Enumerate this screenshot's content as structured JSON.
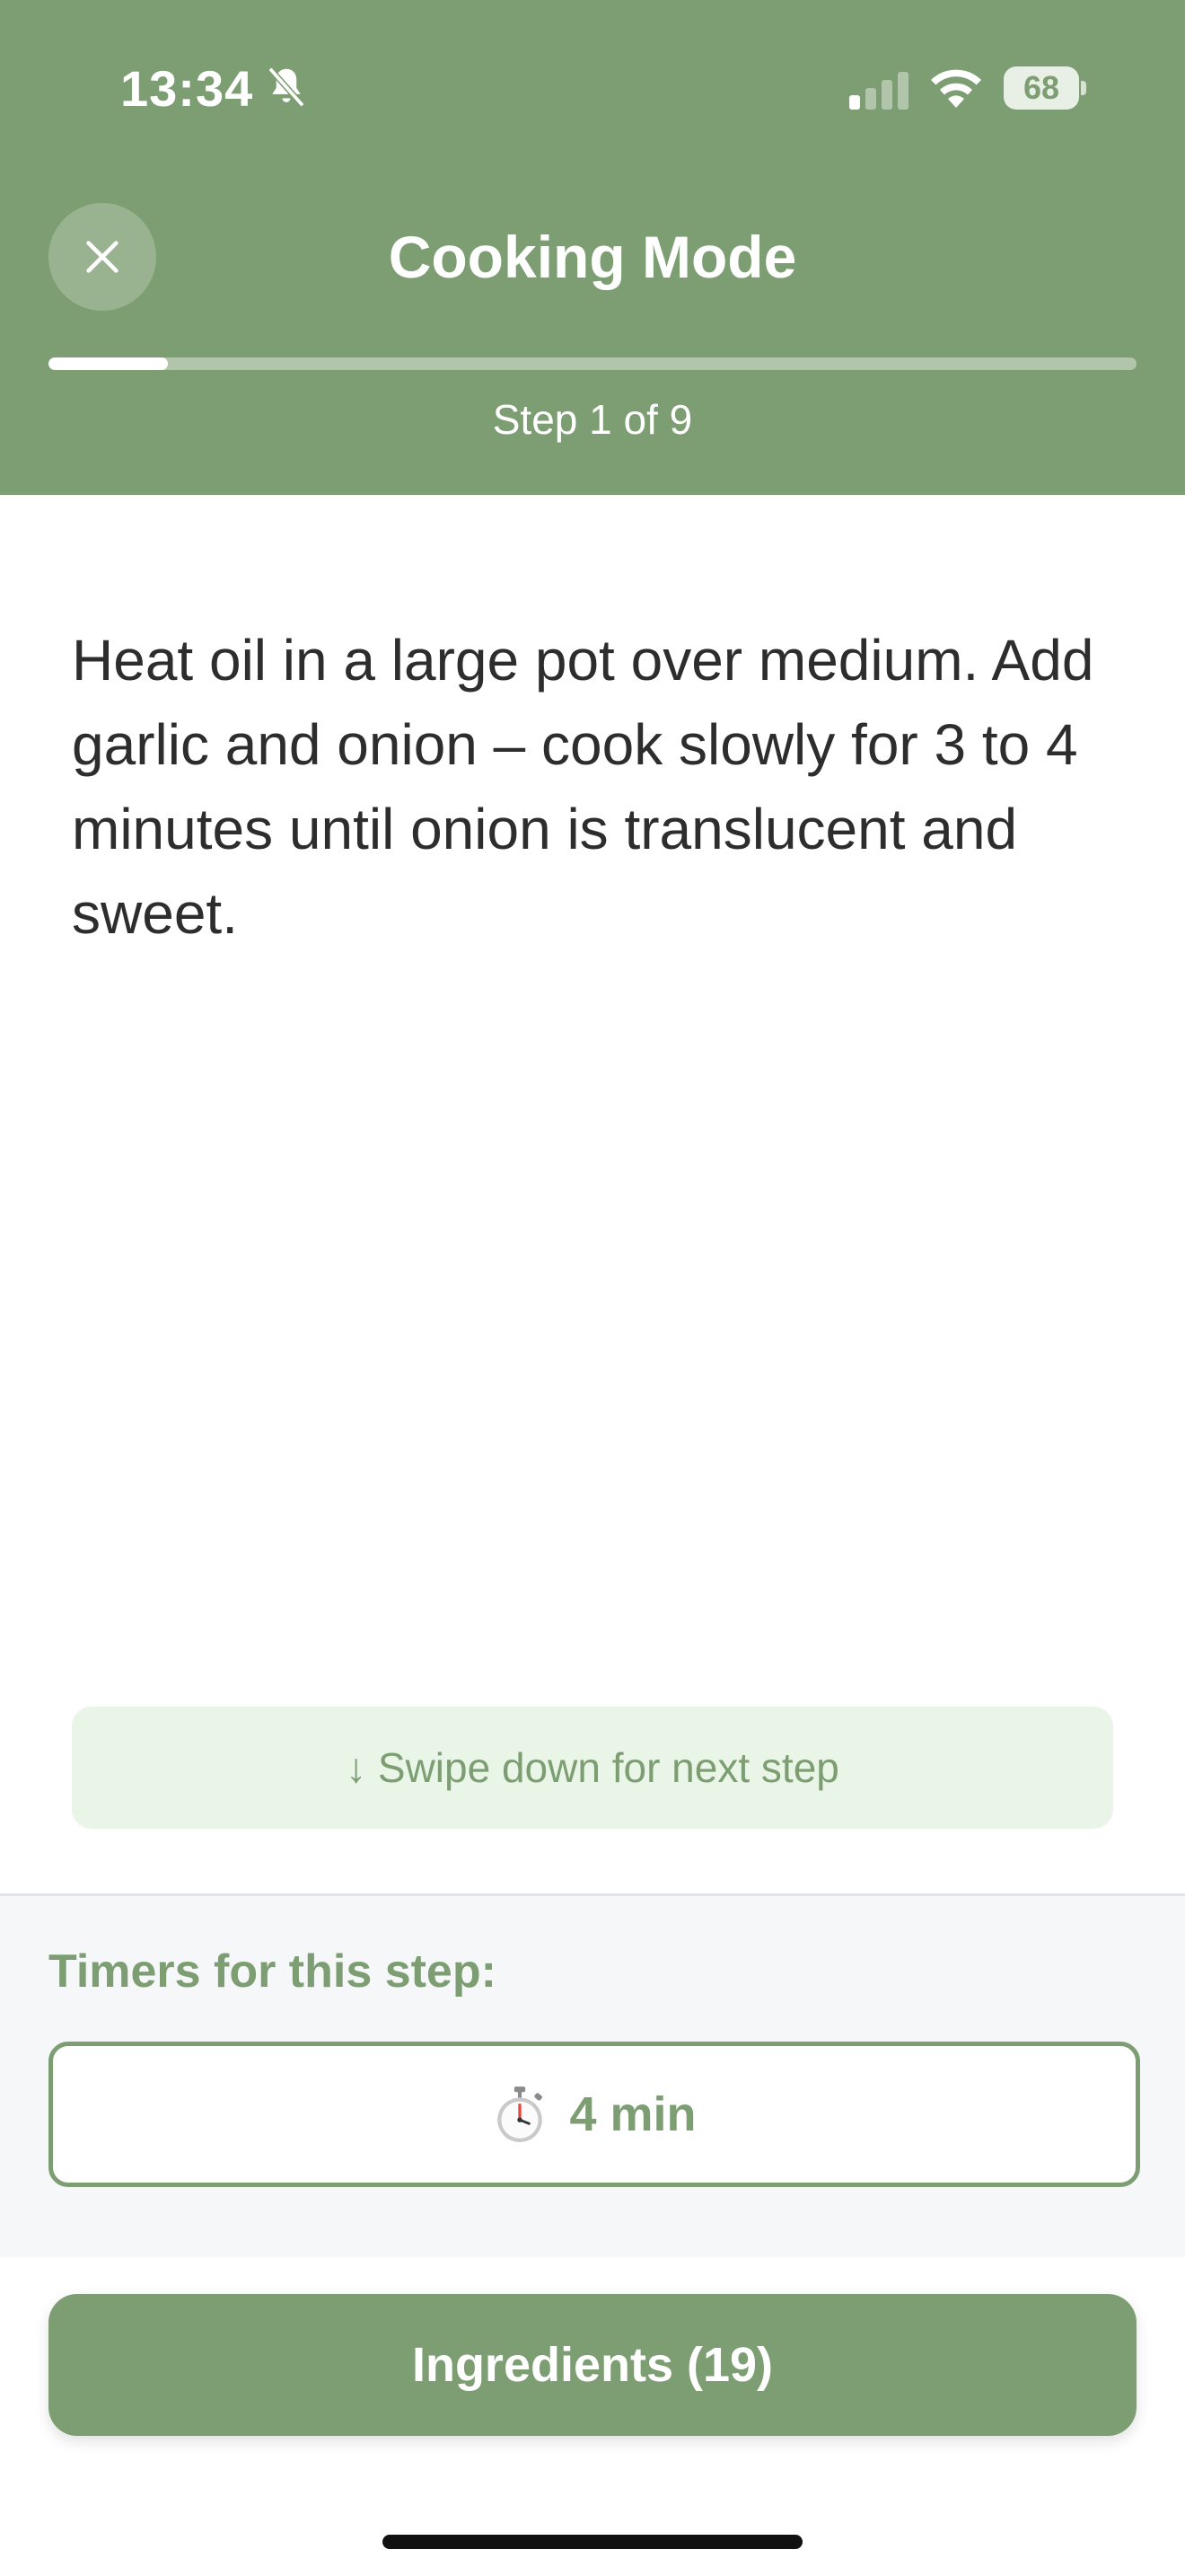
{
  "status_bar": {
    "time": "13:34",
    "battery": "68"
  },
  "header": {
    "title": "Cooking Mode",
    "step_counter": "Step 1 of 9",
    "progress": 0.11,
    "close_icon": "close-icon"
  },
  "step": {
    "text": "Heat oil in a large pot over medium. Add garlic and onion – cook slowly for 3 to 4 minutes until onion is translucent and sweet."
  },
  "swipe_hint": "↓ Swipe down for next step",
  "timers": {
    "label": "Timers for this step:",
    "items": [
      {
        "label": "4 min",
        "icon": "stopwatch-icon"
      }
    ]
  },
  "ingredients_button": "Ingredients (19)",
  "colors": {
    "accent": "#7d9e72",
    "hint_background": "#e9f5e6",
    "panel_background": "#f5f7f9"
  }
}
